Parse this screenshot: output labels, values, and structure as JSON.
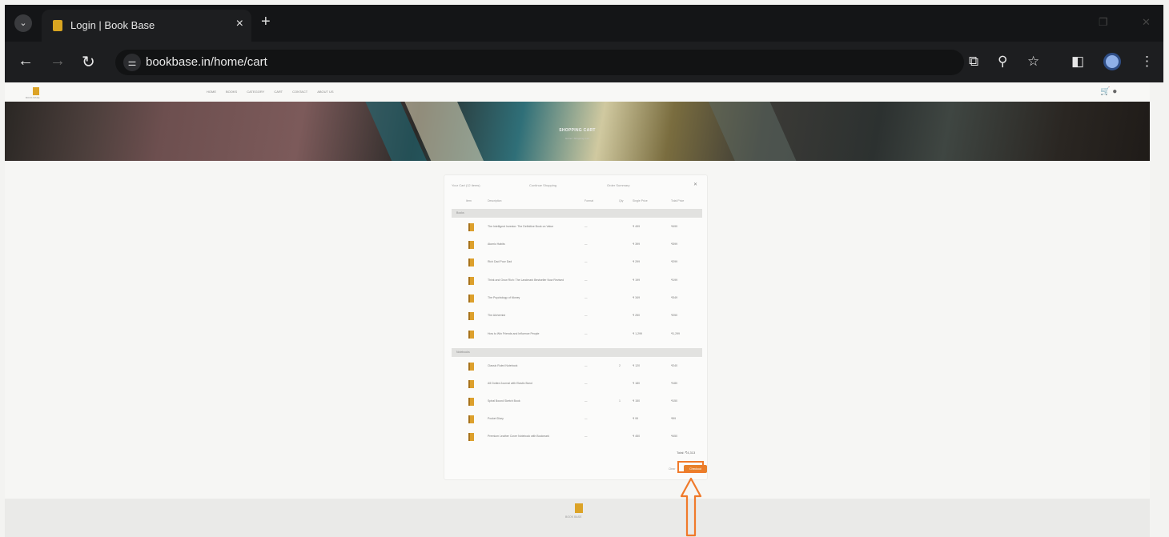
{
  "browser": {
    "tab_title": "Login | Book Base",
    "url": "bookbase.in/home/cart",
    "new_tab_symbol": "+",
    "close_symbol": "×"
  },
  "site": {
    "logo_text": "BOOK BASE",
    "nav": [
      "HOME",
      "BOOKS",
      "CATEGORY",
      "CART",
      "CONTACT",
      "ABOUT US"
    ]
  },
  "hero": {
    "title": "SHOPPING CART",
    "subtitle": "Home / Shopping Cart"
  },
  "cart": {
    "top_labels": [
      "Your Cart (12 items)",
      "Continue Shopping",
      "Order Summary"
    ],
    "columns": [
      "Item",
      "Description",
      "Format",
      "Qty",
      "Single Price",
      "Total Price"
    ],
    "groups": [
      {
        "label": "Books",
        "items": [
          {
            "title": "The Intelligent Investor: The Definitive Book on Value",
            "format": "—",
            "qty": "",
            "price": "₹ 499",
            "total": "₹499"
          },
          {
            "title": "Atomic Habits",
            "format": "—",
            "qty": "",
            "price": "₹ 399",
            "total": "₹399"
          },
          {
            "title": "Rich Dad Poor Dad",
            "format": "—",
            "qty": "",
            "price": "₹ 299",
            "total": "₹299"
          },
          {
            "title": "Think and Grow Rich: The Landmark Bestseller Now Revised",
            "format": "—",
            "qty": "",
            "price": "₹ 199",
            "total": "₹199"
          },
          {
            "title": "The Psychology of Money",
            "format": "—",
            "qty": "",
            "price": "₹ 349",
            "total": "₹349"
          },
          {
            "title": "The Alchemist",
            "format": "—",
            "qty": "",
            "price": "₹ 250",
            "total": "₹250"
          },
          {
            "title": "How to Win Friends and Influence People",
            "format": "—",
            "qty": "",
            "price": "₹ 1,299",
            "total": "₹1,299"
          }
        ]
      },
      {
        "label": "Notebooks",
        "items": [
          {
            "title": "Classic Ruled Notebook",
            "format": "—",
            "qty": "2",
            "price": "₹ 120",
            "total": "₹240"
          },
          {
            "title": "A5 Dotted Journal with Elastic Band",
            "format": "—",
            "qty": "",
            "price": "₹ 180",
            "total": "₹180"
          },
          {
            "title": "Spiral Bound Sketch Book",
            "format": "—",
            "qty": "1",
            "price": "₹ 150",
            "total": "₹150"
          },
          {
            "title": "Pocket Diary",
            "format": "—",
            "qty": "",
            "price": "₹ 99",
            "total": "₹99"
          },
          {
            "title": "Premium Leather Cover Notebook with Bookmark",
            "format": "—",
            "qty": "",
            "price": "₹ 450",
            "total": "₹450"
          }
        ]
      }
    ],
    "total_label": "Total: ₹4,313",
    "cancel_label": "Clear",
    "checkout_label": "Checkout"
  },
  "footer": {
    "logo_text": "BOOK BASE"
  },
  "colors": {
    "accent": "#e8802a",
    "annotation": "#f07a2a",
    "chrome_bg": "#1d1e20"
  }
}
